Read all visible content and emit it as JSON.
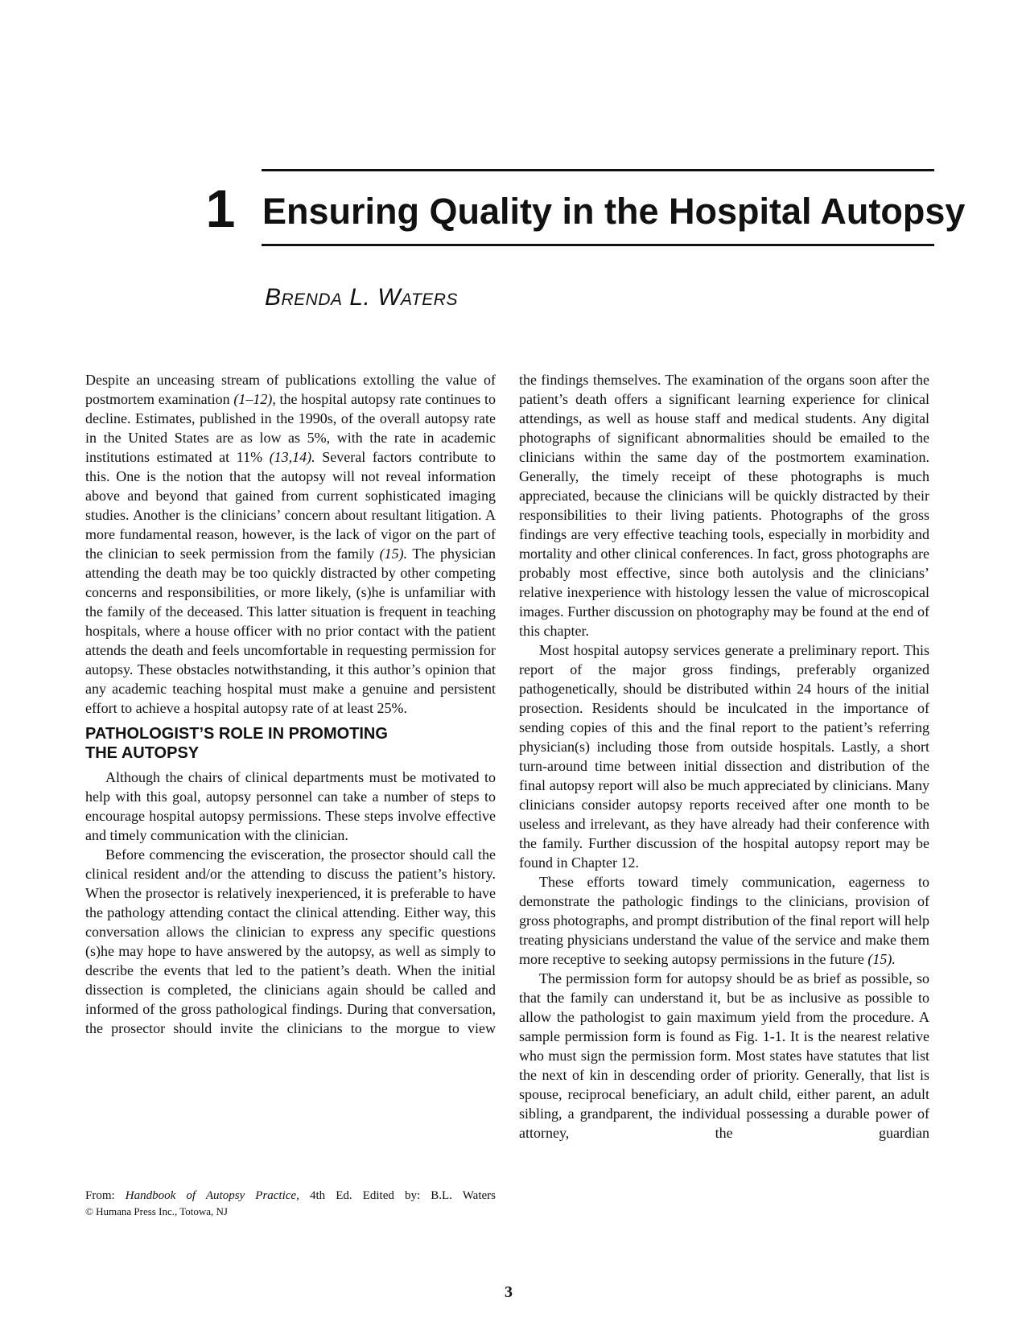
{
  "header": {
    "chapter_number": "1",
    "chapter_title": "Ensuring Quality in the Hospital Autopsy",
    "author": "Brenda L. Waters"
  },
  "left_column": {
    "intro_paragraph": {
      "t1": "Despite an unceasing stream of publications extolling the value of postmortem examination ",
      "ref1": "(1–12),",
      "t2": " the hospital autopsy rate continues to decline. Estimates, published in the 1990s, of the overall autopsy rate in the United States are as low as 5%, with the rate in academic institutions estimated at 11% ",
      "ref2": "(13,14).",
      "t3": " Several factors contribute to this. One is the notion that the autopsy will not reveal information above and beyond that gained from current sophisticated imaging studies. Another is the clinicians’ concern about resultant litigation. A more fundamental reason, however, is the lack of vigor on the part of the clinician to seek permission from the family ",
      "ref3": "(15).",
      "t4": " The physician attending the death may be too quickly distracted by other competing concerns and responsibilities, or more likely, (s)he is unfamiliar with the family of the deceased. This latter situation is frequent in teaching hospitals, where a house officer with no prior contact with the patient attends the death and feels uncomfortable in requesting permission for autopsy. These obstacles notwithstanding, it this author’s opinion that any academic teaching hospital must make a genuine and persistent effort to achieve a hospital autopsy rate of at least 25%."
    },
    "section_heading": {
      "line1": "Pathologist’s Role in Promoting",
      "line2": "the Autopsy"
    },
    "paragraph_2": "Although the chairs of clinical departments must be motivated to help with this goal, autopsy personnel can take a number of steps to encourage hospital autopsy permissions. These steps involve effective and timely communication with the clinician.",
    "paragraph_3": "Before commencing the evisceration, the prosector should call the clinical resident and/or the attending to discuss the patient’s history. When the prosector is relatively inexperienced, it is preferable to have the pathology attending contact the clinical attending. Either way, this conversation allows the clinician to express any specific questions (s)he may hope to have answered by the autopsy, as well as simply to describe the events that led to the patient’s death. When the initial dissection is completed, the clinicians again should be called and informed of the gross pathological findings. During that conversation, the prosector should invite the clinicians to the morgue to view"
  },
  "right_column": {
    "continuation_paragraph": "the findings themselves. The examination of the organs soon after the patient’s death offers a significant learning experience for clinical attendings, as well as house staff and medical students. Any digital photographs of significant abnormalities should be emailed to the clinicians within the same day of the postmortem examination. Generally, the timely receipt of these photographs is much appreciated, because the clinicians will be quickly distracted by their responsibilities to their living patients. Photographs of the gross findings are very effective teaching tools, especially in morbidity and mortality and other clinical conferences. In fact, gross photographs are probably most effective, since both autolysis and the clinicians’ relative inexperience with histology lessen the value of microscopical images. Further discussion on photography may be found at the end of this chapter.",
    "paragraph_2": "Most hospital autopsy services generate a preliminary report. This report of the major gross findings, preferably organized pathogenetically, should be distributed within 24 hours of the initial prosection. Residents should be inculcated in the importance of sending copies of this and the final report to the patient’s referring physician(s) including those from outside hospitals. Lastly, a short turn-around time between initial dissection and distribution of the final autopsy report will also be much appreciated by clinicians. Many clinicians consider autopsy reports received after one month to be useless and irrelevant, as they have already had their conference with the family. Further discussion of the hospital autopsy report may be found in Chapter 12.",
    "paragraph_3": {
      "text": "These efforts toward timely communication, eagerness to demonstrate the pathologic findings to the clinicians, provision of gross photographs, and prompt distribution of the final report will help treating physicians understand the value of the service and make them more receptive to seeking autopsy permissions in the future ",
      "ref": "(15)."
    },
    "paragraph_4": "The permission form for autopsy should be as brief as possible, so that the family can understand it, but be as inclusive as possible to allow the pathologist to gain maximum yield from the procedure. A sample permission form is found as Fig. 1-1. It is the nearest relative who must sign the permission form. Most states have statutes that list the next of kin in descending order of priority. Generally, that list is spouse, reciprocal beneficiary, an adult child, either parent, an adult sibling, a grandparent, the individual possessing a durable power of attorney, the guardian"
  },
  "footnote": {
    "prefix": "From: ",
    "book_title": "Handbook of Autopsy Practice,",
    "suffix": " 4th Ed. Edited by: B.L. Waters",
    "publisher": "© Humana Press Inc., Totowa, NJ"
  },
  "page_number": "3"
}
